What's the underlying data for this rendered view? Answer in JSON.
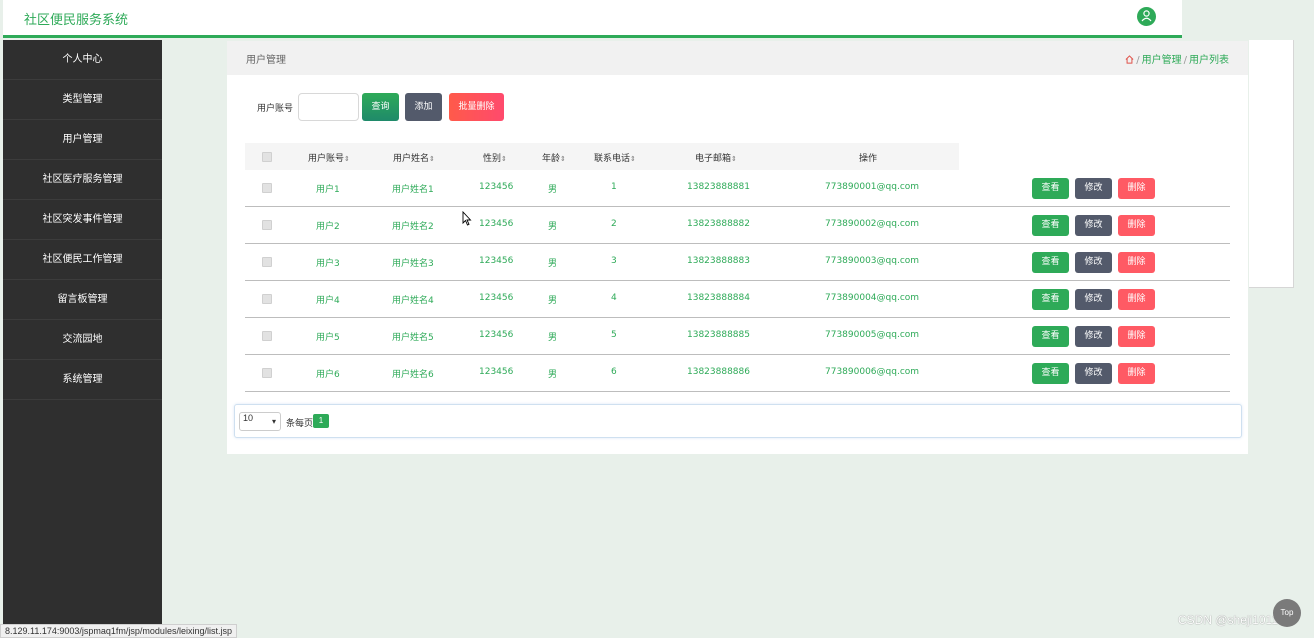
{
  "app": {
    "title": "社区便民服务系统"
  },
  "sidebar": {
    "items": [
      {
        "label": "个人中心"
      },
      {
        "label": "类型管理"
      },
      {
        "label": "用户管理"
      },
      {
        "label": "社区医疗服务管理"
      },
      {
        "label": "社区突发事件管理"
      },
      {
        "label": "社区便民工作管理"
      },
      {
        "label": "留言板管理"
      },
      {
        "label": "交流园地"
      },
      {
        "label": "系统管理"
      }
    ]
  },
  "page": {
    "title": "用户管理",
    "breadcrumb": [
      "用户管理",
      "用户列表"
    ]
  },
  "search": {
    "label": "用户账号",
    "value": "",
    "query_button": "查询",
    "add_button": "添加",
    "batch_delete_button": "批量删除"
  },
  "table": {
    "columns": [
      "用户账号",
      "用户姓名",
      "性别",
      "年龄",
      "联系电话",
      "电子邮箱",
      "操作"
    ],
    "rows": [
      {
        "account": "用户1",
        "name": "用户姓名1",
        "gender": "123456",
        "age": "男",
        "phone": "1",
        "email": "13823888881",
        "extra": "773890001@qq.com"
      },
      {
        "account": "用户2",
        "name": "用户姓名2",
        "gender": "123456",
        "age": "男",
        "phone": "2",
        "email": "13823888882",
        "extra": "773890002@qq.com"
      },
      {
        "account": "用户3",
        "name": "用户姓名3",
        "gender": "123456",
        "age": "男",
        "phone": "3",
        "email": "13823888883",
        "extra": "773890003@qq.com"
      },
      {
        "account": "用户4",
        "name": "用户姓名4",
        "gender": "123456",
        "age": "男",
        "phone": "4",
        "email": "13823888884",
        "extra": "773890004@qq.com"
      },
      {
        "account": "用户5",
        "name": "用户姓名5",
        "gender": "123456",
        "age": "男",
        "phone": "5",
        "email": "13823888885",
        "extra": "773890005@qq.com"
      },
      {
        "account": "用户6",
        "name": "用户姓名6",
        "gender": "123456",
        "age": "男",
        "phone": "6",
        "email": "13823888886",
        "extra": "773890006@qq.com"
      }
    ],
    "actions": {
      "view": "查看",
      "edit": "修改",
      "delete": "删除"
    }
  },
  "pagination": {
    "page_size": "10",
    "per_page_label": "条每页",
    "current_page": "1"
  },
  "status_url": "8.129.11.174:9003/jspmaq1fm/jsp/modules/leixing/list.jsp",
  "watermark": "CSDN @sheji1011",
  "top_button": "Top",
  "colors": {
    "accent": "#2eaa58",
    "sidebar": "#2f2f2f",
    "danger": "#ff5a64",
    "neutral": "#535a6b"
  }
}
